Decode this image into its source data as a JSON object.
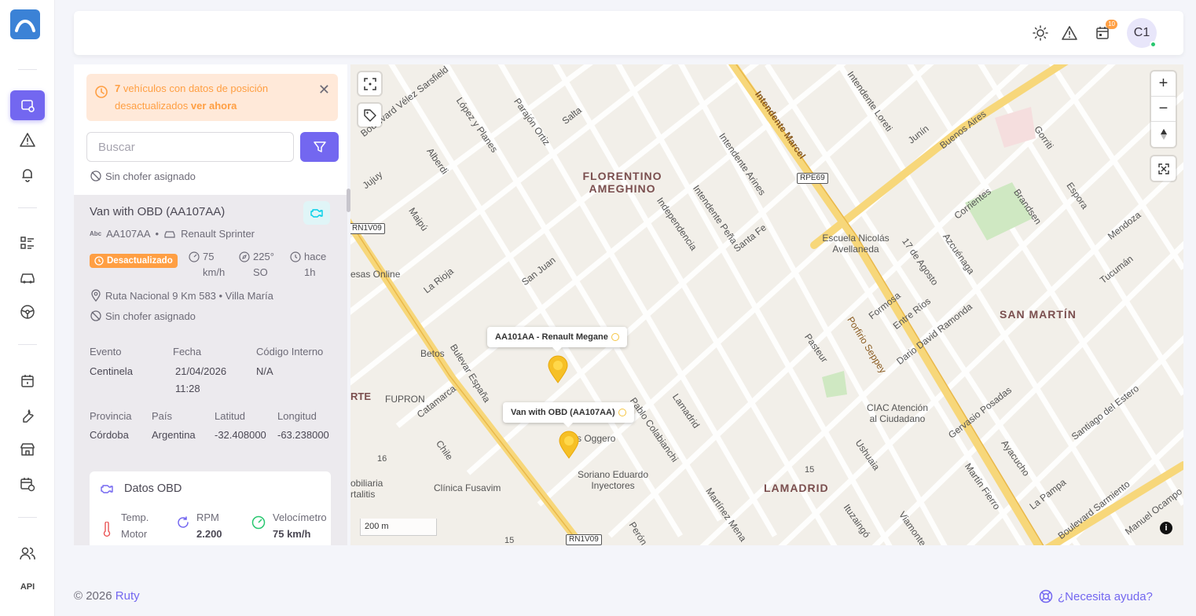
{
  "topbar": {
    "theme_icon": "sun-icon",
    "alerts_icon": "alert-triangle-icon",
    "calendar_badge": "10",
    "avatar_initials": "C1"
  },
  "sidebar": {
    "items": [
      {
        "icon": "vehicle-tracking-icon",
        "active": true
      },
      {
        "icon": "alert-triangle-icon"
      },
      {
        "icon": "bell-icon"
      },
      {
        "icon": "list-icon"
      },
      {
        "icon": "car-icon"
      },
      {
        "icon": "steering-wheel-icon"
      },
      {
        "icon": "calendar-icon"
      },
      {
        "icon": "wrench-icon"
      },
      {
        "icon": "store-icon"
      },
      {
        "icon": "calendar-clock-icon"
      },
      {
        "icon": "users-icon"
      },
      {
        "label": "API"
      }
    ]
  },
  "alert": {
    "count": "7",
    "text": " vehículos con datos de posición desactualizados",
    "link": "ver ahora"
  },
  "search": {
    "placeholder": "Buscar"
  },
  "filter_label": "Sin chofer asignado",
  "vehicle": {
    "title": "Van with OBD (AA107AA)",
    "plate": "AA107AA",
    "model": "Renault Sprinter",
    "status": "Desactualizado",
    "speed": "75 km/h",
    "heading": "225° SO",
    "time": "hace 1h",
    "location": "Ruta Nacional 9 Km 583 • Villa María",
    "driver": "Sin chofer asignado",
    "fields": {
      "evento_label": "Evento",
      "evento": "Centinela",
      "fecha_label": "Fecha",
      "fecha": "21/04/2026 11:28",
      "codigo_label": "Código Interno",
      "codigo": "N/A",
      "provincia_label": "Provincia",
      "provincia": "Córdoba",
      "pais_label": "País",
      "pais": "Argentina",
      "latitud_label": "Latitud",
      "latitud": "-32.408000",
      "longitud_label": "Longitud",
      "longitud": "-63.238000"
    },
    "obd": {
      "title": "Datos OBD",
      "temp_label": "Temp. Motor",
      "rpm_label": "RPM",
      "rpm": "2.200",
      "vel_label": "Velocímetro",
      "vel": "75 km/h"
    }
  },
  "map": {
    "districts": [
      "FLORENTINO AMEGHINO",
      "SAN MARTÍN",
      "LAMADRID"
    ],
    "popups": [
      "AA101AA - Renault Megane",
      "Van with OBD (AA107AA)"
    ],
    "scale": "200 m",
    "shields": [
      "RPE69",
      "RN1V09",
      "RN1V09"
    ],
    "pois": [
      "Escuela Nicolás Avellaneda",
      "CIAC Atención al Ciudadano",
      "Soriano Eduardo Inyectores",
      "Clínica Fusavim",
      "FUPRON",
      "Betos",
      "esas Online",
      "s Oggero",
      "obiliaria rtalitis",
      "RTE"
    ],
    "streets": [
      "Boulevard Vélez Sarsfield",
      "López y Planes",
      "Parajón Ortiz",
      "Salta",
      "Alberdi",
      "Jujuy",
      "Maipú",
      "La Rioja",
      "San Juan",
      "Independencia",
      "Intendente Peña",
      "Santa Fe",
      "Intendente Arines",
      "Intendente Marcel",
      "Intendente Loreti",
      "Junín",
      "Buenos Aires",
      "Gorriti",
      "Corrientes",
      "Brandsen",
      "Espora",
      "Mendoza",
      "Tucumán",
      "17 de Agosto",
      "Azcuénaga",
      "Formosa",
      "Entre Ríos",
      "Dario David Ramonda",
      "Porfirio Seppey",
      "Pasteur",
      "Lamadrid",
      "Bulevar España",
      "Catamarca",
      "Chile",
      "Pablo Colabianchi",
      "Ushuaia",
      "Martín Fierro",
      "Ituzaingó",
      "Viamonte",
      "Gervasio Posadas",
      "Ayacucho",
      "Santiago del Estero",
      "La Pampa",
      "Boulevard Sarmiento",
      "Manuel Ocampo",
      "Martínez Mena",
      "Perón"
    ],
    "numbers": [
      "16",
      "15",
      "15"
    ]
  },
  "footer": {
    "copyright": "© 2026 ",
    "brand": "Ruty",
    "help": "¿Necesita ayuda?"
  },
  "colors": {
    "primary": "#7367f0",
    "warning": "#ff9f43",
    "success": "#28c76f"
  }
}
